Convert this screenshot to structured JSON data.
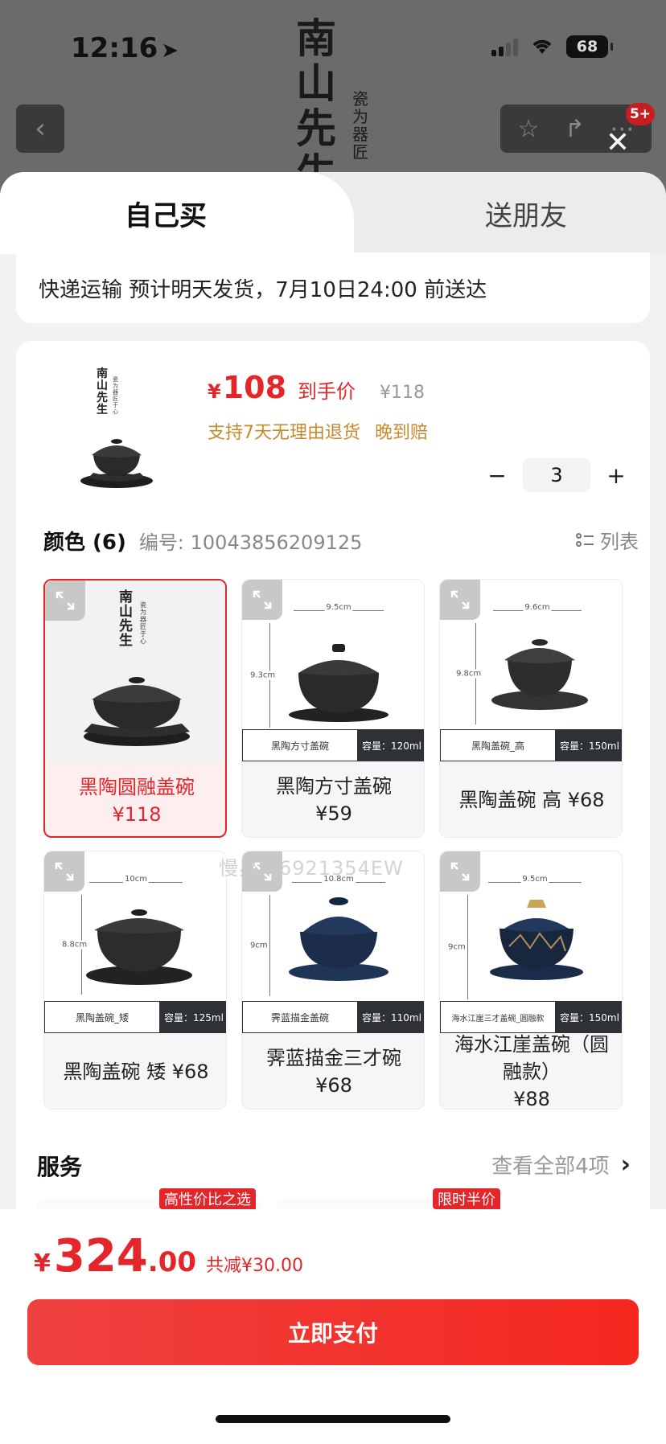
{
  "status": {
    "time": "12:16",
    "battery": "68"
  },
  "background": {
    "logo_main": "南山先生",
    "logo_sub": "瓷为器 匠"
  },
  "badge": "5+",
  "tabs": [
    "自己买",
    "送朋友"
  ],
  "delivery": "快递运输 预计明天发货，7月10日24:00 前送达",
  "product": {
    "thumb_logo": "南山先生",
    "thumb_logo_sub": "瓷为器 匠于心",
    "currency": "¥",
    "price": "108",
    "price_label": "到手价",
    "orig_price": "¥118",
    "services": [
      "支持7天无理由退货",
      "晚到赔"
    ],
    "qty": "3",
    "minus": "−",
    "plus": "+"
  },
  "color": {
    "title": "颜色 (6)",
    "sku": "编号: 10043856209125",
    "list_label": "列表",
    "items": [
      {
        "name": "黑陶圆融盖碗",
        "price": "¥118",
        "selected": true,
        "logo": "南山先生",
        "logo_sub": "瓷为器 匠于心"
      },
      {
        "name": "黑陶方寸盖碗",
        "price": "¥59",
        "strip_left": "黑陶方寸盖碗",
        "strip_right": "容量：120ml",
        "w": "9.5cm",
        "h": "9.3cm"
      },
      {
        "name": "黑陶盖碗 高 ¥68",
        "price": "",
        "strip_left": "黑陶盖碗_高",
        "strip_right": "容量：150ml",
        "w": "9.6cm",
        "h": "9.8cm"
      },
      {
        "name": "黑陶盖碗 矮 ¥68",
        "price": "",
        "strip_left": "黑陶盖碗_矮",
        "strip_right": "容量：125ml",
        "w": "10cm",
        "h": "8.8cm"
      },
      {
        "name": "霁蓝描金三才碗",
        "price": "¥68",
        "strip_left": "霁蓝描金盖碗",
        "strip_right": "容量：110ml",
        "w": "10.8cm",
        "h": "9cm"
      },
      {
        "name": "海水江崖盖碗（圆融款）",
        "price": "¥88",
        "strip_left": "海水江崖三才盖碗_圆融款",
        "strip_right": "容量：150ml",
        "w": "9.5cm",
        "h": "9cm"
      }
    ]
  },
  "watermark": "慢星人6921354EW",
  "services": {
    "title": "服务",
    "more": "查看全部4项",
    "tags": [
      "高性价比之选",
      "限时半价"
    ]
  },
  "footer": {
    "currency": "¥",
    "total_int": "324",
    "total_dec": ".00",
    "discount": "共减¥30.00",
    "pay_label": "立即支付"
  },
  "colors": {
    "accent": "#e4262a",
    "gold": "#c68a2e"
  }
}
